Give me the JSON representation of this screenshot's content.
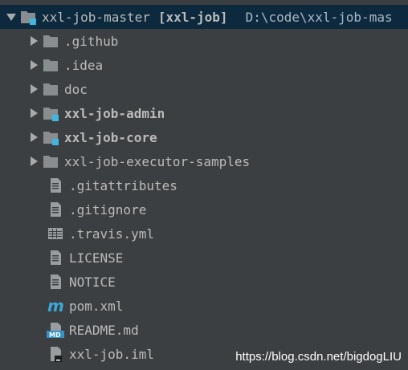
{
  "root": {
    "name": "xxl-job-master",
    "module": "[xxl-job]",
    "path": "D:\\code\\xxl-job-mas"
  },
  "folders": [
    {
      "label": ".github",
      "bold": false,
      "module": false
    },
    {
      "label": ".idea",
      "bold": false,
      "module": false
    },
    {
      "label": "doc",
      "bold": false,
      "module": false
    },
    {
      "label": "xxl-job-admin",
      "bold": true,
      "module": true
    },
    {
      "label": "xxl-job-core",
      "bold": true,
      "module": true
    },
    {
      "label": "xxl-job-executor-samples",
      "bold": false,
      "module": false
    }
  ],
  "files": [
    {
      "label": ".gitattributes",
      "icon": "text-file-icon"
    },
    {
      "label": ".gitignore",
      "icon": "text-file-icon"
    },
    {
      "label": ".travis.yml",
      "icon": "yaml-file-icon"
    },
    {
      "label": "LICENSE",
      "icon": "text-file-icon"
    },
    {
      "label": "NOTICE",
      "icon": "text-file-icon"
    },
    {
      "label": "pom.xml",
      "icon": "maven-icon"
    },
    {
      "label": "README.md",
      "icon": "markdown-icon"
    },
    {
      "label": "xxl-job.iml",
      "icon": "iml-file-icon"
    }
  ],
  "watermark": "https://blog.csdn.net/bigdogLIU",
  "colors": {
    "background": "#3c3f41",
    "selection": "#0d293e",
    "folder": "#8a8d90",
    "module_marker": "#40b6e0",
    "maven": "#3aa8d8"
  }
}
